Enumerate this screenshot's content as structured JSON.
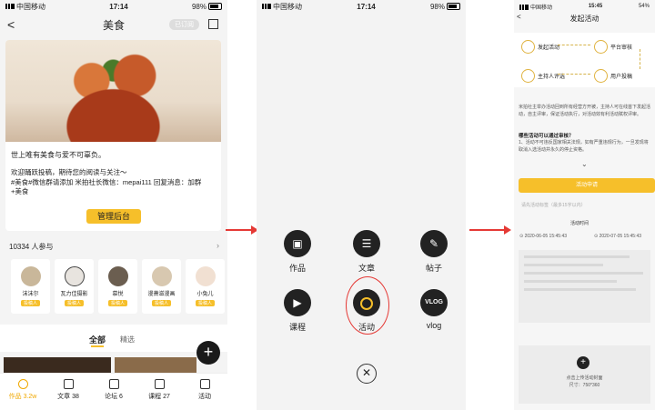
{
  "panel1": {
    "status": {
      "carrier": "中国移动",
      "time": "17:14",
      "battery": "98%"
    },
    "nav": {
      "back": "<",
      "title": "美食",
      "badge": "已订阅"
    },
    "card": {
      "line1": "世上唯有美食与爱不可辜负。",
      "line2": "欢迎踊跃投稿，期待您的阅读与关注～",
      "line3": "#美食#微信群请添加 米拍社长微信：mepai111 回复消息：加群",
      "line4": "+美食",
      "manage_button": "管理后台"
    },
    "participants_label": "10334 人参与",
    "participants": [
      {
        "name": "沫沫尔",
        "tag": "投稿人"
      },
      {
        "name": "瓦力佳摄影",
        "tag": "投稿人"
      },
      {
        "name": "慕悦",
        "tag": "投稿人"
      },
      {
        "name": "漫萧滋漫画",
        "tag": "投稿人"
      },
      {
        "name": "小兔儿",
        "tag": "投稿人"
      }
    ],
    "filters": {
      "all": "全部",
      "selected": "精选"
    },
    "tabs": [
      {
        "label": "作品 3.2w",
        "active": true
      },
      {
        "label": "文章 38",
        "active": false
      },
      {
        "label": "论坛 6",
        "active": false
      },
      {
        "label": "课程 27",
        "active": false
      },
      {
        "label": "活动",
        "active": false
      }
    ]
  },
  "panel2": {
    "status": {
      "carrier": "中国移动",
      "time": "17:14",
      "battery": "98%"
    },
    "items": [
      {
        "label": "作品",
        "icon": "image-icon"
      },
      {
        "label": "文章",
        "icon": "article-icon"
      },
      {
        "label": "帖子",
        "icon": "post-icon"
      },
      {
        "label": "课程",
        "icon": "course-icon"
      },
      {
        "label": "活动",
        "icon": "activity-icon"
      },
      {
        "label": "vlog",
        "icon": "vlog-icon"
      }
    ],
    "vlog_badge": "VLOG"
  },
  "panel3": {
    "status": {
      "carrier": "中国移动",
      "time": "15:45",
      "battery": "54%"
    },
    "nav": {
      "back": "<",
      "title": "发起活动"
    },
    "flow": [
      "发起活动",
      "平台审核",
      "主持人评选",
      "用户投稿"
    ],
    "desc": "米拍社主举办活动回到所有经营方开被，主持人可在线首下发起活动，自主评审，保证活动执行，对活动效有利活动赋权评审。",
    "q_title": "哪些活动可以通过审核？",
    "q_body": "1、活动不可违反国家相关法规，如有严重违规行为，一旦发现将取消入选活动并永久的停止资格。",
    "apply_button": "活动申请",
    "form_hint": "请先活动标签（最多15字以内）",
    "time_label": "活动时间",
    "start_time": "2020-06-05 15:45:43",
    "end_time": "2020-07-05 15:45:43",
    "upload_text": "点击上传活动封面",
    "upload_size": "尺寸：750*360"
  },
  "colors": {
    "accent": "#f6bf2a",
    "arrow": "#e53935"
  }
}
